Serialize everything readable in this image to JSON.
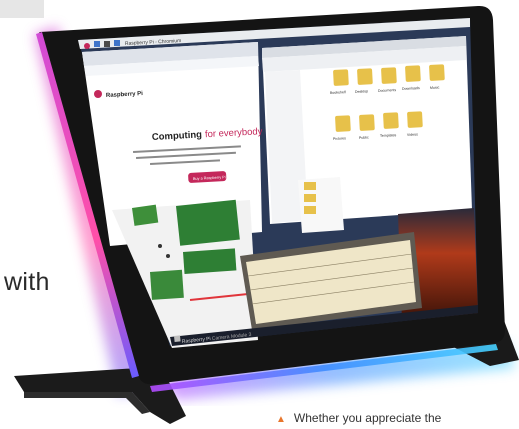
{
  "side_text": "with",
  "caption": "Whether you appreciate the",
  "browser": {
    "tab_title": "Raspberry Pi - Chromium",
    "page_brand": "Raspberry Pi",
    "headline_part1": "Computing",
    "headline_part2": "for everybody",
    "cta": "Buy a Raspberry Pi"
  },
  "file_manager": {
    "folders": [
      "Bookshelf",
      "Desktop",
      "Documents",
      "Downloads",
      "Music",
      "Pictures",
      "Public",
      "Templates",
      "Videos"
    ]
  },
  "bezel_brand": "Raspberry Pi",
  "bezel_product": "Camera Module 3",
  "colors": {
    "bezel": "#141414",
    "glow_pink": "#e23fb5",
    "glow_blue": "#3fa6ff",
    "folder": "#e7c14a"
  }
}
